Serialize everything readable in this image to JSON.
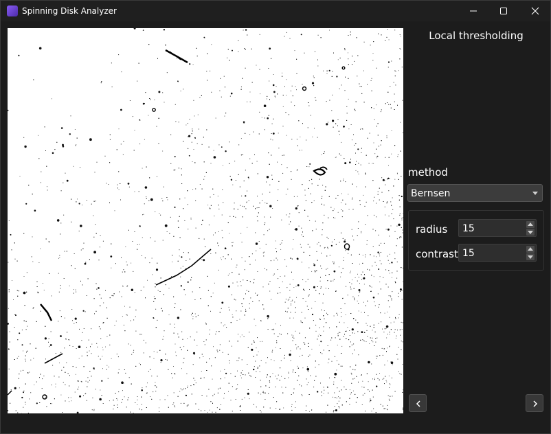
{
  "window": {
    "title": "Spinning Disk Analyzer",
    "icons": {
      "app": "app-icon",
      "minimize": "minimize-icon",
      "maximize": "maximize-icon",
      "close": "close-icon"
    }
  },
  "panel": {
    "title": "Local thresholding",
    "method_label": "method",
    "method_value": "Bernsen",
    "params": {
      "radius_label": "radius",
      "radius_value": "15",
      "contrast_label": "contrast",
      "contrast_value": "15"
    }
  },
  "nav": {
    "prev_icon": "chevron-left-icon",
    "next_icon": "chevron-right-icon"
  },
  "colors": {
    "background": "#1c1c1c",
    "field": "#3c3c3c",
    "accent": "#8a5cf6",
    "image_background": "#ffffff",
    "image_foreground": "#000000"
  }
}
